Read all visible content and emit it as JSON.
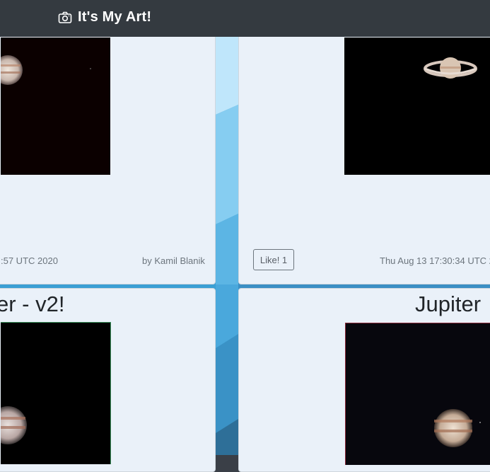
{
  "app": {
    "title": "It's My Art!"
  },
  "cards": [
    {
      "date": ":57 UTC 2020",
      "author": "by Kamil Blanik"
    },
    {
      "like_label": "Like! 1",
      "date": "Thu Aug 13 17:30:34 UTC 20"
    },
    {
      "title": "er - v2!"
    },
    {
      "title": "Jupiter"
    }
  ],
  "colors": {
    "navbar": "#343a40",
    "card_bg": "#eaf1f9",
    "accent_blue": "#3fa7d6"
  }
}
